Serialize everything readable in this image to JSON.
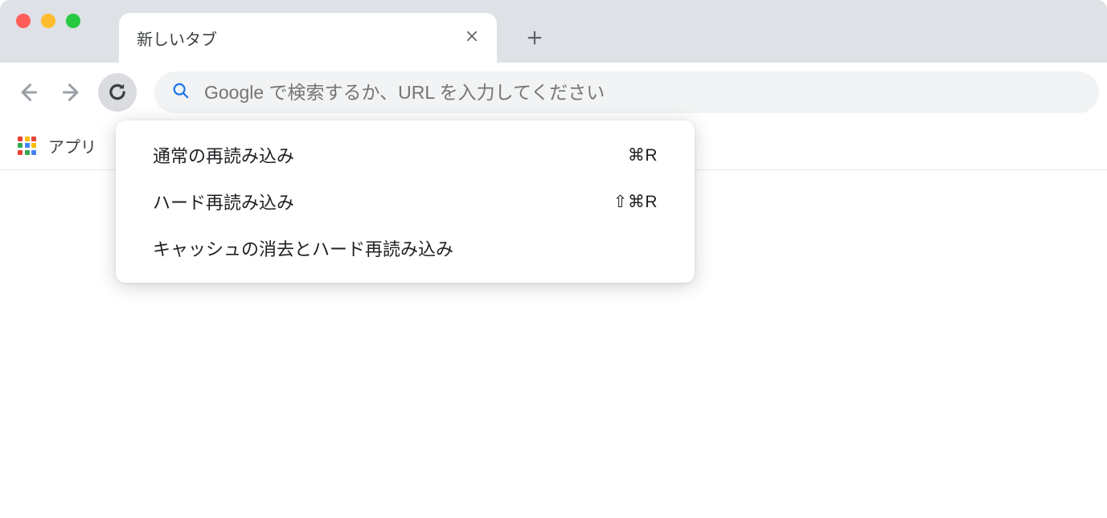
{
  "tab": {
    "title": "新しいタブ"
  },
  "omnibox": {
    "placeholder": "Google で検索するか、URL を入力してください"
  },
  "bookmarks_bar": {
    "apps_label": "アプリ"
  },
  "context_menu": {
    "items": [
      {
        "label": "通常の再読み込み",
        "shortcut": "⌘R"
      },
      {
        "label": "ハード再読み込み",
        "shortcut": "⇧⌘R"
      },
      {
        "label": "キャッシュの消去とハード再読み込み",
        "shortcut": ""
      }
    ]
  }
}
